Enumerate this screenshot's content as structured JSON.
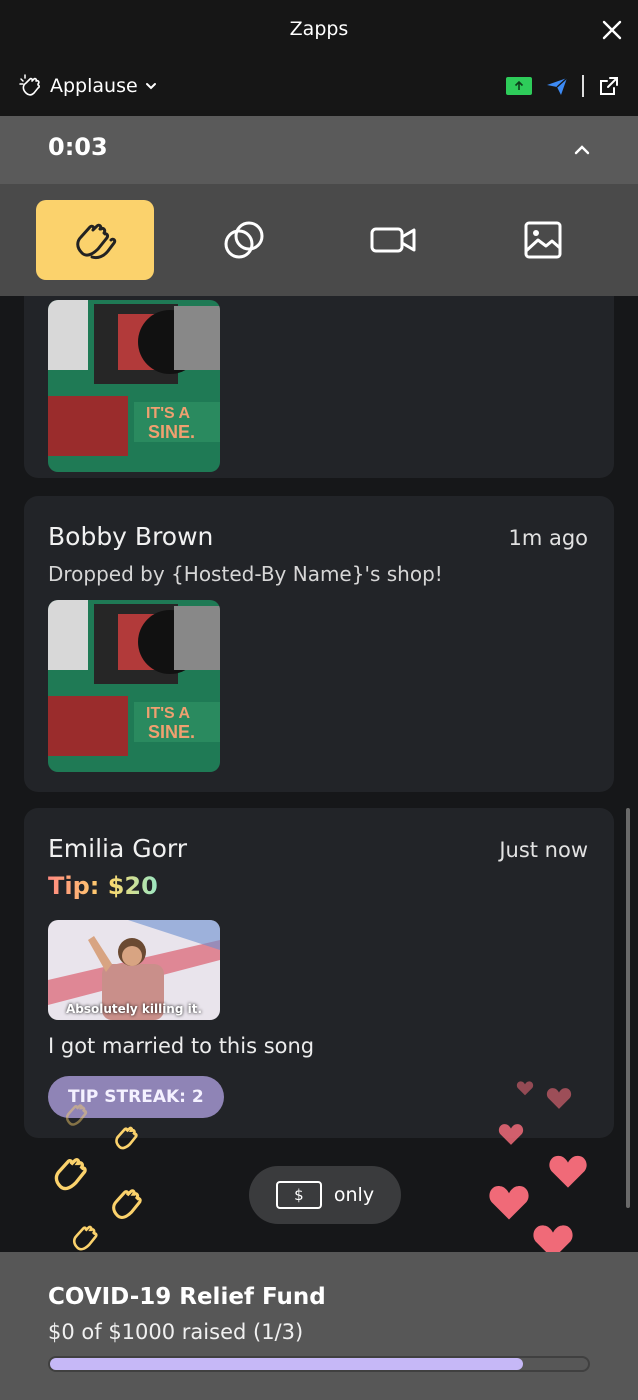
{
  "window": {
    "title": "Zapps"
  },
  "header": {
    "reaction_mode": "Applause"
  },
  "timer": {
    "value": "0:03"
  },
  "feed": {
    "items": [
      {
        "name": "Bobby Brown",
        "time": "1m ago",
        "subtitle": "Dropped by {Hosted-By Name}'s shop!"
      },
      {
        "name": "Emilia Gorr",
        "time": "Just now",
        "tip_label": "Tip: $20",
        "gif_caption": "Absolutely killing it.",
        "message": "I got married to this song",
        "streak": "TIP STREAK: 2"
      }
    ]
  },
  "filter": {
    "dollar_symbol": "$",
    "label": "only"
  },
  "fund": {
    "title": "COVID-19 Relief Fund",
    "raised": "$0 of $1000 raised (1/3)",
    "progress_fraction": 0.88
  },
  "colors": {
    "accent_yellow": "#fbd26c",
    "progress_purple": "#c6b8f7",
    "heart_pink": "#f06a78",
    "upload_green": "#2ecc5a",
    "send_blue": "#3d8bf5"
  },
  "icons": [
    "close-icon",
    "applause-icon",
    "chevron-down-icon",
    "upload-icon",
    "send-icon",
    "external-link-icon",
    "chevron-up-icon",
    "circles-icon",
    "video-icon",
    "image-icon"
  ]
}
